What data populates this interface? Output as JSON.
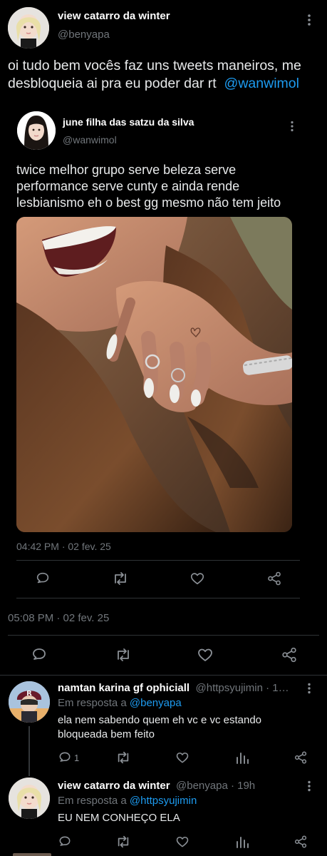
{
  "main_tweet": {
    "display_name": "view catarro da winter",
    "handle": "@benyapa",
    "text": "oi tudo bem vocês faz uns tweets maneiros, me desbloqueia ai pra eu poder dar rt",
    "mention": "@wanwimol",
    "timestamp": "05:08 PM · 02 fev. 25"
  },
  "quoted_tweet": {
    "display_name": "june filha das satzu da silva",
    "handle": "@wanwimol",
    "text": "twice melhor grupo serve beleza serve performance serve cunty e ainda rende lesbianismo eh o best gg mesmo não tem jeito",
    "timestamp": "04:42 PM · 02 fev. 25"
  },
  "replies": [
    {
      "display_name": "namtan karina gf ophiciall",
      "handle_time": "@httpsyujimin · 1…",
      "reply_to_label": "Em resposta a",
      "reply_to": "@benyapa",
      "text": "ela nem sabendo quem eh vc e vc estando bloqueada bem feito",
      "reply_count": "1"
    },
    {
      "display_name": "view catarro da winter",
      "handle_time": "@benyapa · 19h",
      "reply_to_label": "Em resposta a",
      "reply_to": "@httpsyujimin",
      "text": "EU NEM CONHEÇO ELA"
    }
  ],
  "icons": {
    "more": "more-vertical-icon",
    "reply": "reply-icon",
    "retweet": "retweet-icon",
    "like": "heart-icon",
    "share": "share-icon",
    "views": "analytics-icon"
  },
  "colors": {
    "background": "#000000",
    "text": "#e7e9ea",
    "muted": "#71767b",
    "link": "#1d9bf0",
    "divider": "#2f3336"
  }
}
